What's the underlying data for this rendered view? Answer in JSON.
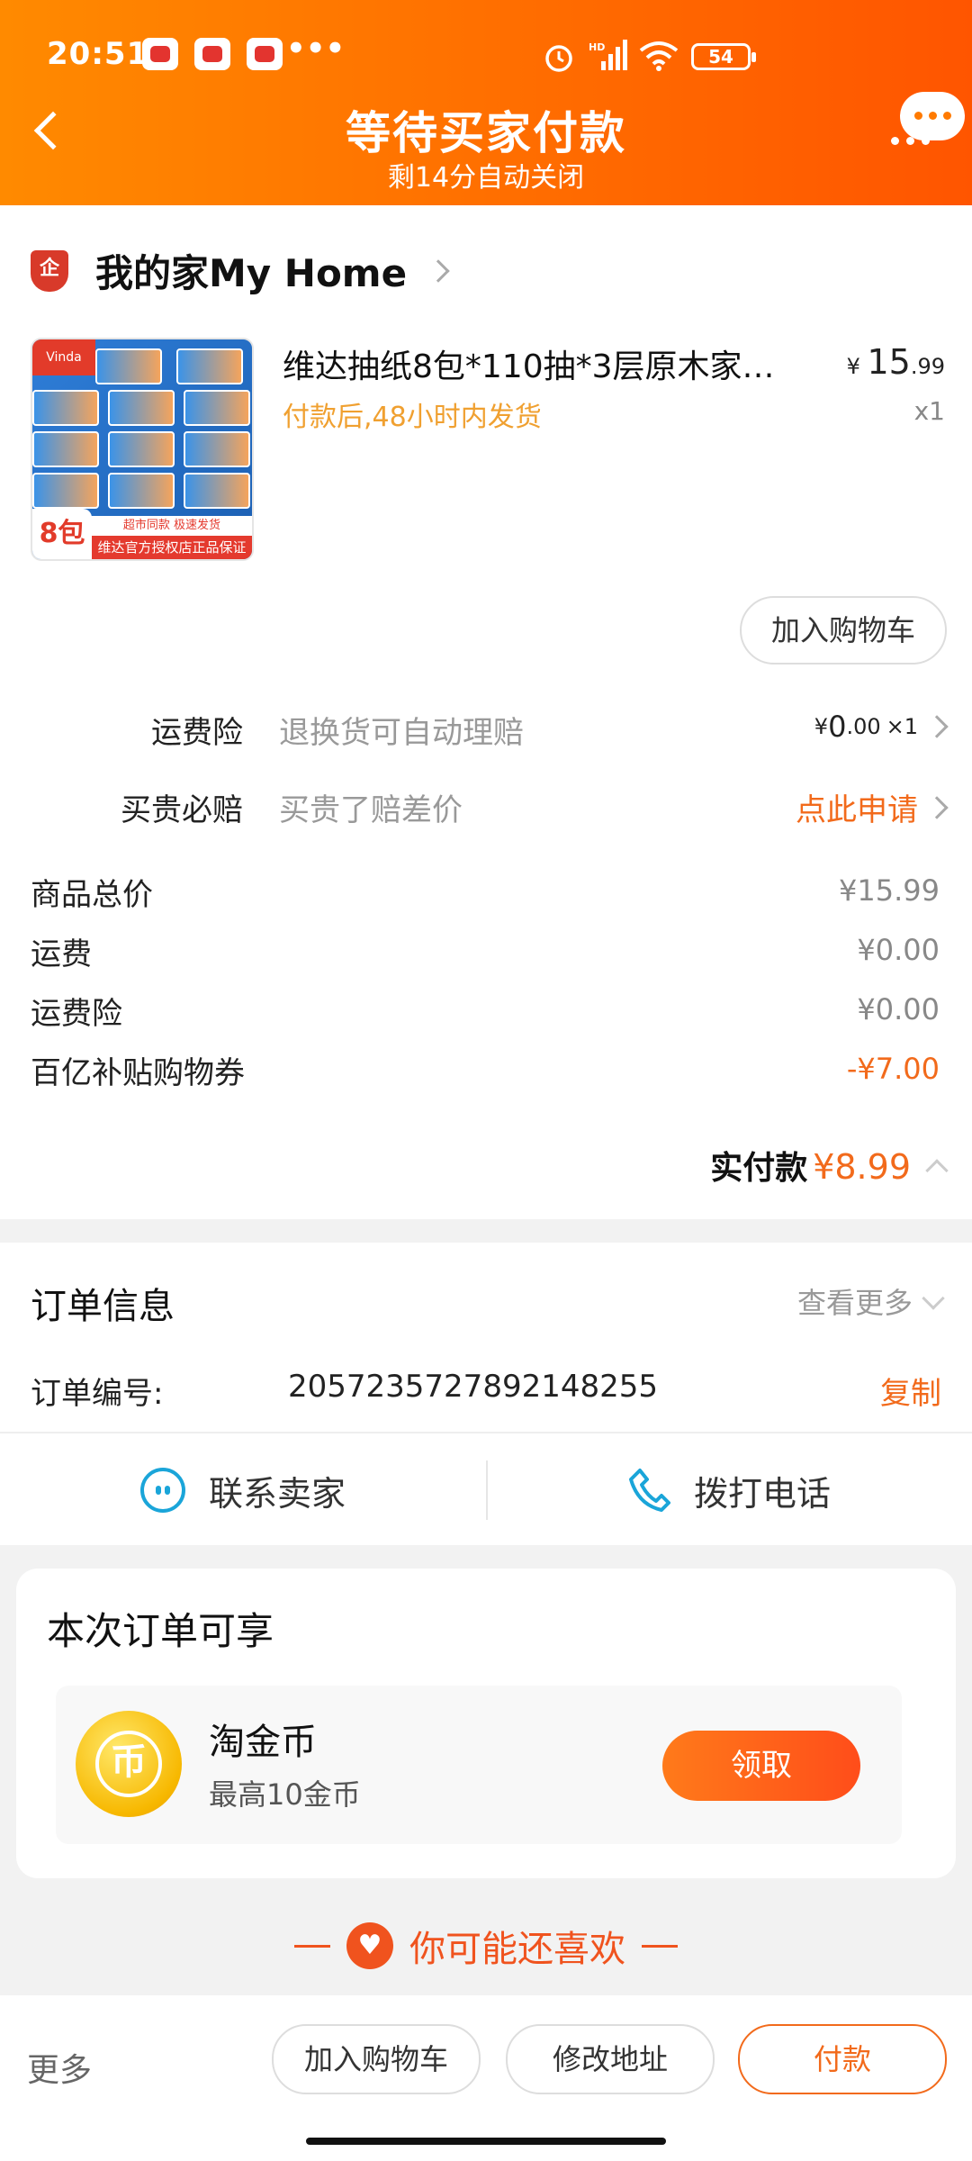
{
  "status_bar": {
    "time": "20:51",
    "more": "•••",
    "battery": "54"
  },
  "header": {
    "title": "等待买家付款",
    "subtitle": "剩14分自动关闭"
  },
  "shop": {
    "badge": "企",
    "name": "我的家My Home"
  },
  "product": {
    "title": "维达抽纸8包*110抽*3层原木家…",
    "delivery": "付款后,48小时内发货",
    "price_int": "15",
    "price_dec": ".99",
    "qty": "x1",
    "image_badge": "8包",
    "image_strip1": "超市同款 极速发货",
    "image_strip2": "维达官方授权店正品保证",
    "image_logo": "Vinda",
    "add_cart": "加入购物车"
  },
  "services": [
    {
      "label": "运费险",
      "desc": "退换货可自动理赔",
      "value_int": "0",
      "value_dec": ".00",
      "value_qty": "×1"
    },
    {
      "label": "买贵必赔",
      "desc": "买贵了赔差价",
      "action": "点此申请"
    }
  ],
  "fees": [
    {
      "label": "商品总价",
      "amount": "¥15.99"
    },
    {
      "label": "运费",
      "amount": "¥0.00"
    },
    {
      "label": "运费险",
      "amount": "¥0.00"
    },
    {
      "label": "百亿补贴购物券",
      "amount": "-¥7.00"
    }
  ],
  "paid": {
    "label": "实付款",
    "amount": "¥8.99"
  },
  "order_info": {
    "title": "订单信息",
    "more": "查看更多",
    "number_label": "订单编号:",
    "number": "2057235727892148255",
    "copy": "复制"
  },
  "contact": {
    "seller": "联系卖家",
    "phone": "拨打电话"
  },
  "benefit": {
    "title": "本次订单可享",
    "coin_name": "淘金币",
    "coin_desc": "最高10金币",
    "claim": "领取"
  },
  "recommend": "你可能还喜欢",
  "bottom_bar": {
    "more": "更多",
    "add_cart": "加入购物车",
    "edit_address": "修改地址",
    "pay": "付款"
  },
  "colors": {
    "header": "#ff6a00",
    "accent": "#f26a1b",
    "info_icon": "#1aa5d9"
  }
}
